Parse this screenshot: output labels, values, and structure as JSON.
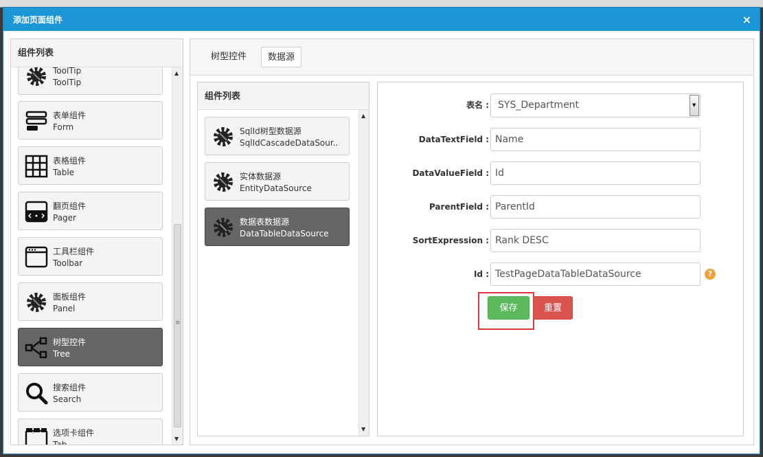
{
  "dialog": {
    "title": "添加页面组件",
    "close_glyph": "×"
  },
  "left_panel": {
    "header": "组件列表",
    "items": [
      {
        "label": "ToolTip",
        "sub": "ToolTip",
        "icon": "gear-icon"
      },
      {
        "label": "表单组件",
        "sub": "Form",
        "icon": "form-icon"
      },
      {
        "label": "表格组件",
        "sub": "Table",
        "icon": "table-icon"
      },
      {
        "label": "翻页组件",
        "sub": "Pager",
        "icon": "pager-icon"
      },
      {
        "label": "工具栏组件",
        "sub": "Toolbar",
        "icon": "toolbar-icon"
      },
      {
        "label": "面板组件",
        "sub": "Panel",
        "icon": "gear-icon"
      },
      {
        "label": "树型控件",
        "sub": "Tree",
        "icon": "tree-icon",
        "active": true
      },
      {
        "label": "搜索组件",
        "sub": "Search",
        "icon": "search-icon"
      },
      {
        "label": "选项卡组件",
        "sub": "Tab",
        "icon": "tab-icon"
      }
    ]
  },
  "tabs": [
    {
      "label": "树型控件",
      "selected": false
    },
    {
      "label": "数据源",
      "selected": true
    }
  ],
  "datasource_panel": {
    "header": "组件列表",
    "items": [
      {
        "label": "SqlId树型数据源",
        "sub": "SqlIdCascadeDataSour..",
        "icon": "gear-icon"
      },
      {
        "label": "实体数据源",
        "sub": "EntityDataSource",
        "icon": "gear-icon"
      },
      {
        "label": "数据表数据源",
        "sub": "DataTableDataSource",
        "icon": "gear-icon",
        "active": true
      }
    ]
  },
  "form": {
    "table_name": {
      "label": "表名 :",
      "value": "SYS_Department"
    },
    "data_text_field": {
      "label": "DataTextField :",
      "value": "Name"
    },
    "data_value_field": {
      "label": "DataValueField :",
      "value": "Id"
    },
    "parent_field": {
      "label": "ParentField :",
      "value": "ParentId"
    },
    "sort_expression": {
      "label": "SortExpression :",
      "value": "Rank DESC"
    },
    "id_field": {
      "label": "Id :",
      "value": "TestPageDataTableDataSource"
    },
    "help_glyph": "?",
    "save_label": "保存",
    "reset_label": "重置"
  },
  "colors": {
    "titlebar": "#1d96d8",
    "save": "#5cb85c",
    "reset": "#d9534f",
    "highlight": "#d9383a",
    "help": "#f0a23a"
  }
}
